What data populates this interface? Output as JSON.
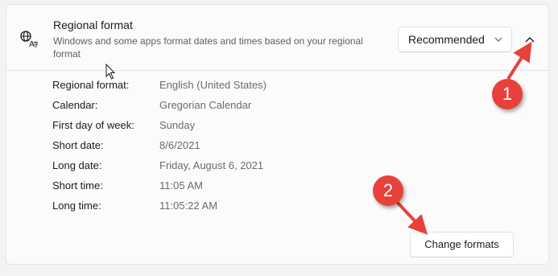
{
  "regional_format": {
    "title": "Regional format",
    "description": "Windows and some apps format dates and times based on your regional format",
    "dropdown_value": "Recommended",
    "icon": "language-globe-icon",
    "collapse_icon": "chevron-up-icon"
  },
  "details": [
    {
      "label": "Regional format:",
      "value": "English (United States)"
    },
    {
      "label": "Calendar:",
      "value": "Gregorian Calendar"
    },
    {
      "label": "First day of week:",
      "value": "Sunday"
    },
    {
      "label": "Short date:",
      "value": "8/6/2021"
    },
    {
      "label": "Long date:",
      "value": "Friday, August 6, 2021"
    },
    {
      "label": "Short time:",
      "value": "11:05 AM"
    },
    {
      "label": "Long time:",
      "value": "11:05:22 AM"
    }
  ],
  "change_button_label": "Change formats",
  "annotations": {
    "badge_1": "1",
    "badge_2": "2",
    "color": "#e8413b"
  }
}
